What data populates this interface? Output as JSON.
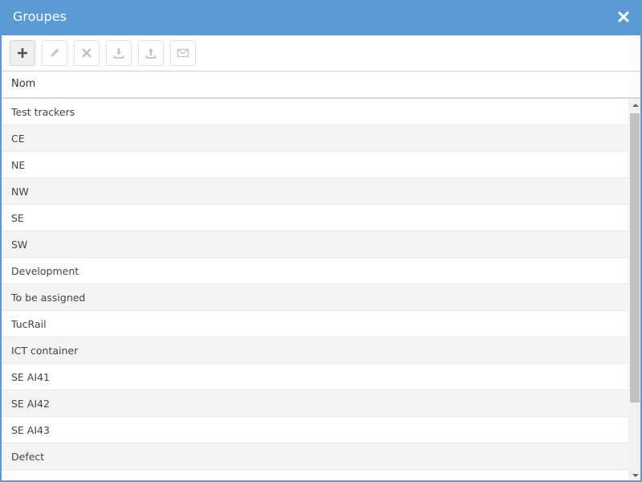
{
  "window": {
    "title": "Groupes"
  },
  "toolbar": {
    "buttons": [
      {
        "icon": "plus-icon"
      },
      {
        "icon": "pencil-icon"
      },
      {
        "icon": "x-icon"
      },
      {
        "icon": "download-icon"
      },
      {
        "icon": "upload-icon"
      },
      {
        "icon": "envelope-icon"
      }
    ]
  },
  "table": {
    "column_header": "Nom",
    "rows": [
      "Test trackers",
      "CE",
      "NE",
      "NW",
      "SE",
      "SW",
      "Development",
      "To be assigned",
      "TucRail",
      "ICT container",
      "SE AI41",
      "SE AI42",
      "SE AI43",
      "Defect",
      "..."
    ]
  },
  "colors": {
    "accent": "#5b9bd5",
    "row_alt": "#f4f4f4"
  }
}
